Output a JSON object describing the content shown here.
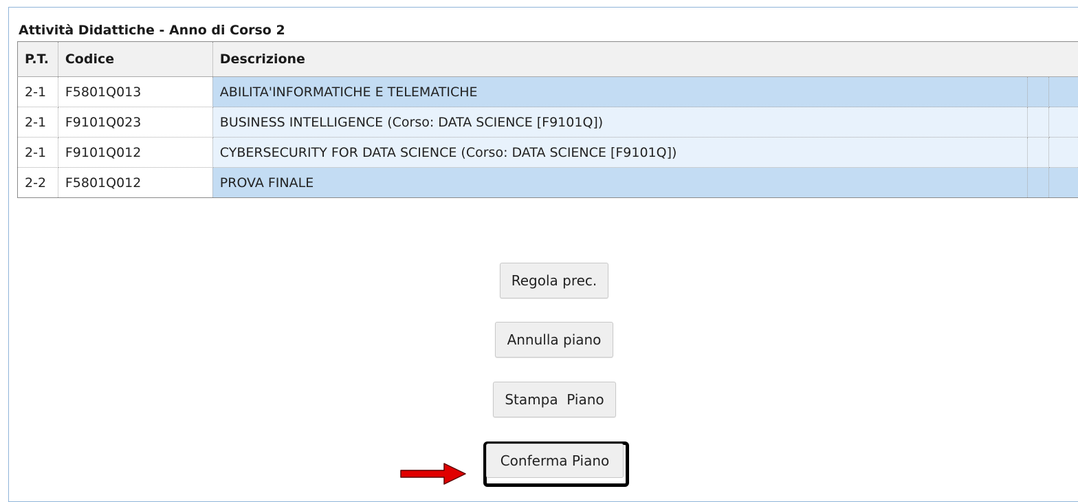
{
  "section": {
    "title": "Attività Didattiche - Anno di Corso 2"
  },
  "table": {
    "headers": {
      "pt": "P.T.",
      "code": "Codice",
      "description": "Descrizione"
    },
    "rows": [
      {
        "pt": "2-1",
        "code": "F5801Q013",
        "description": "ABILITA'INFORMATICHE E TELEMATICHE",
        "shade": "dark"
      },
      {
        "pt": "2-1",
        "code": "F9101Q023",
        "description": "BUSINESS INTELLIGENCE (Corso: DATA SCIENCE [F9101Q])",
        "shade": "light"
      },
      {
        "pt": "2-1",
        "code": "F9101Q012",
        "description": "CYBERSECURITY FOR DATA SCIENCE (Corso: DATA SCIENCE [F9101Q])",
        "shade": "light"
      },
      {
        "pt": "2-2",
        "code": "F5801Q012",
        "description": "PROVA FINALE",
        "shade": "dark"
      }
    ]
  },
  "buttons": {
    "previous_rule": "Regola prec.",
    "cancel_plan": "Annulla piano",
    "print_plan": "Stampa  Piano",
    "confirm_plan": "Conferma Piano"
  },
  "colors": {
    "row_dark": "#c3dcf3",
    "row_light": "#e8f2fc",
    "arrow": "#e00000",
    "frame_border": "#8fb4d9"
  },
  "icons": {
    "annotation": "red-arrow-right-icon"
  }
}
